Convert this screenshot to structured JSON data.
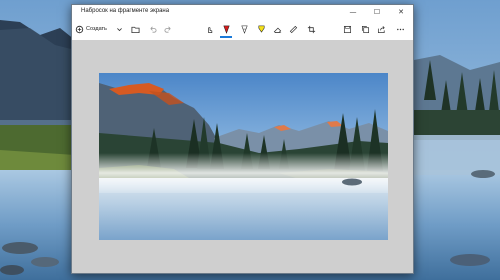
{
  "window": {
    "title": "Набросок на фрагменте экрана",
    "controls": [
      {
        "icon": "minimize-icon",
        "glyph": "—"
      },
      {
        "icon": "maximize-icon",
        "glyph": "☐"
      },
      {
        "icon": "close-icon",
        "glyph": "✕"
      }
    ]
  },
  "toolbar": {
    "create_label": "Создать",
    "items": [
      {
        "icon": "new-snip-icon"
      },
      {
        "icon": "dropdown-chevron-icon"
      },
      {
        "icon": "open-folder-icon"
      },
      {
        "icon": "undo-icon"
      },
      {
        "icon": "redo-icon"
      },
      {
        "icon": "touch-writing-icon"
      },
      {
        "icon": "ballpoint-pen-icon",
        "color": "#d41c1c",
        "active": true
      },
      {
        "icon": "pencil-icon"
      },
      {
        "icon": "highlighter-icon",
        "color": "#f5e11a"
      },
      {
        "icon": "eraser-icon"
      },
      {
        "icon": "ruler-icon"
      },
      {
        "icon": "crop-icon"
      },
      {
        "icon": "save-icon"
      },
      {
        "icon": "copy-icon"
      },
      {
        "icon": "share-icon"
      },
      {
        "icon": "more-icon"
      }
    ]
  },
  "colors": {
    "accent": "#1a7ad9",
    "canvas": "#cfcfcf",
    "pen_red": "#d41c1c",
    "highlighter_yellow": "#f5e11a"
  }
}
